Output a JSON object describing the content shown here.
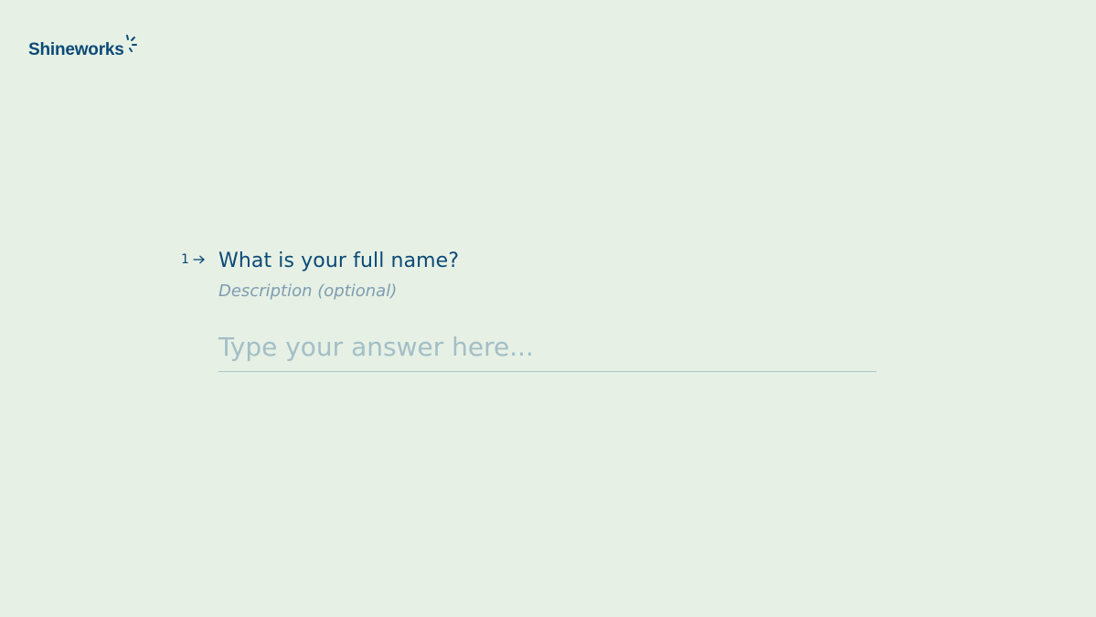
{
  "brand": {
    "name": "Shineworks",
    "logo_icon": "sparkle-icon",
    "color": "#0b4a76"
  },
  "question": {
    "number": "1",
    "arrow_icon": "arrow-right-icon",
    "title": "What is your full name?",
    "description": "Description (optional)",
    "answer": {
      "placeholder": "Type your answer here...",
      "value": ""
    }
  },
  "colors": {
    "background": "#e6f0e5",
    "primary_text": "#0b4a76",
    "placeholder_text": "#a3bec6",
    "description_text": "#7f9db0",
    "input_underline": "#a9c6c8"
  }
}
